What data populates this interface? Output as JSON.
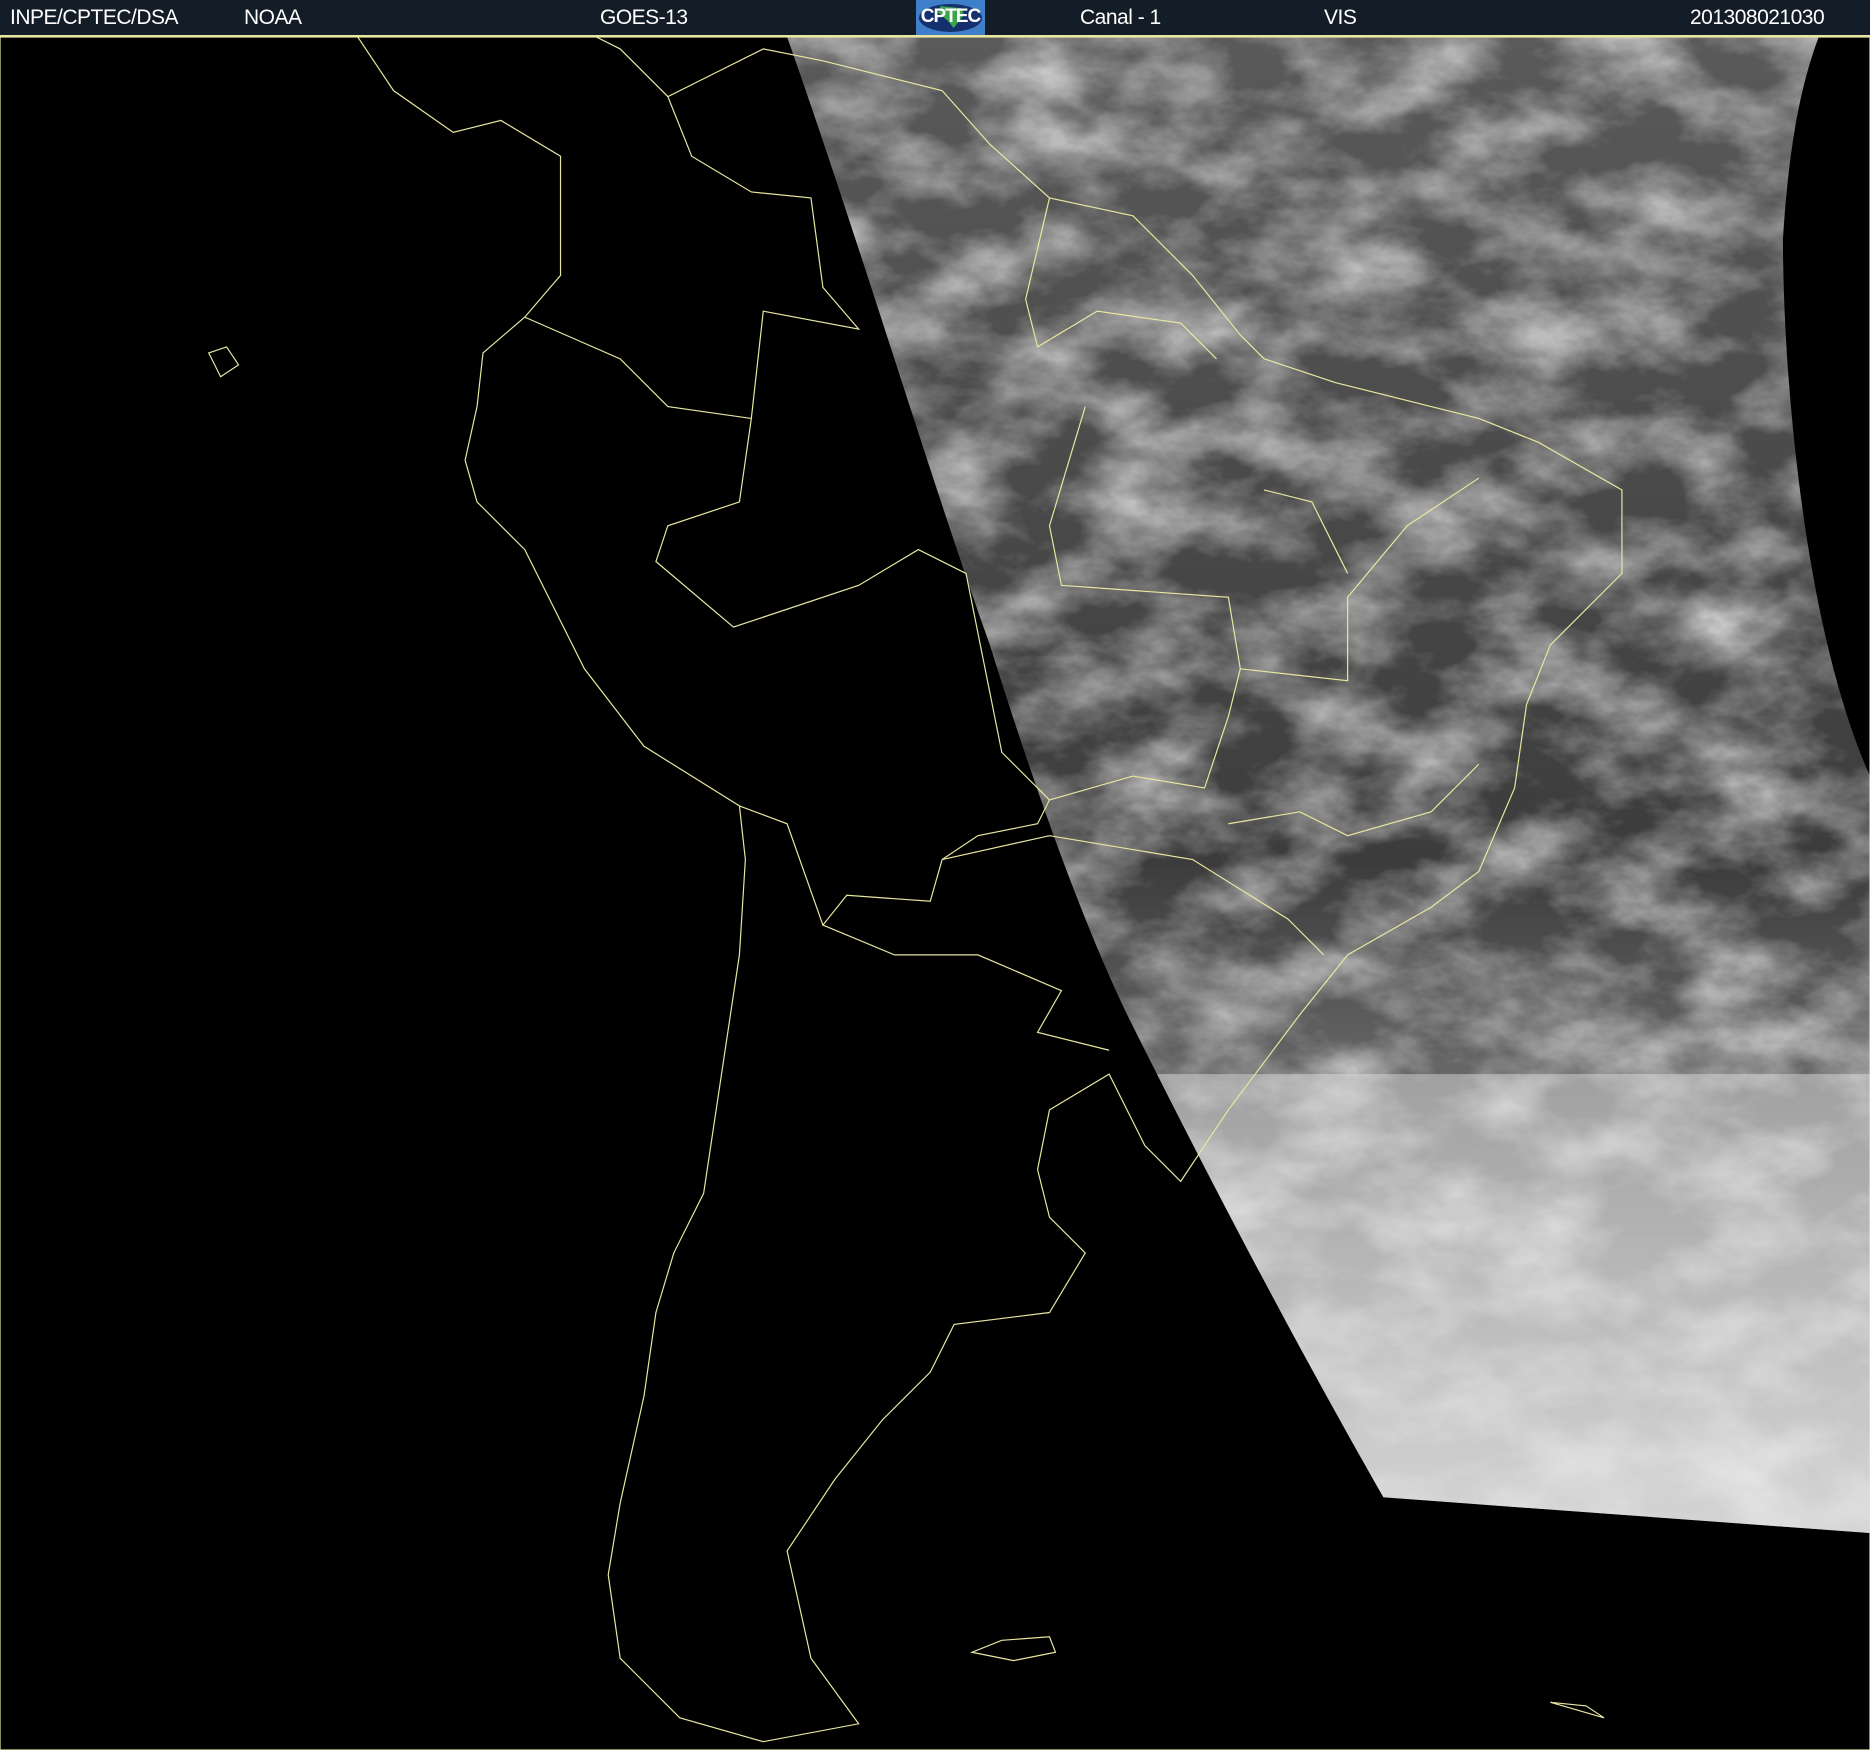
{
  "header": {
    "source": "INPE/CPTEC/DSA",
    "agency": "NOAA",
    "satellite": "GOES-13",
    "logo_text": "CPTEC",
    "channel": "Canal - 1",
    "band": "VIS",
    "timestamp": "201308021030"
  },
  "colors": {
    "header_bg": "#121d27",
    "coastline": "#e8e6a0",
    "background": "#000000"
  },
  "map": {
    "region": "South America",
    "layers": [
      "satellite-visible-imagery",
      "coastlines",
      "political-borders"
    ]
  }
}
